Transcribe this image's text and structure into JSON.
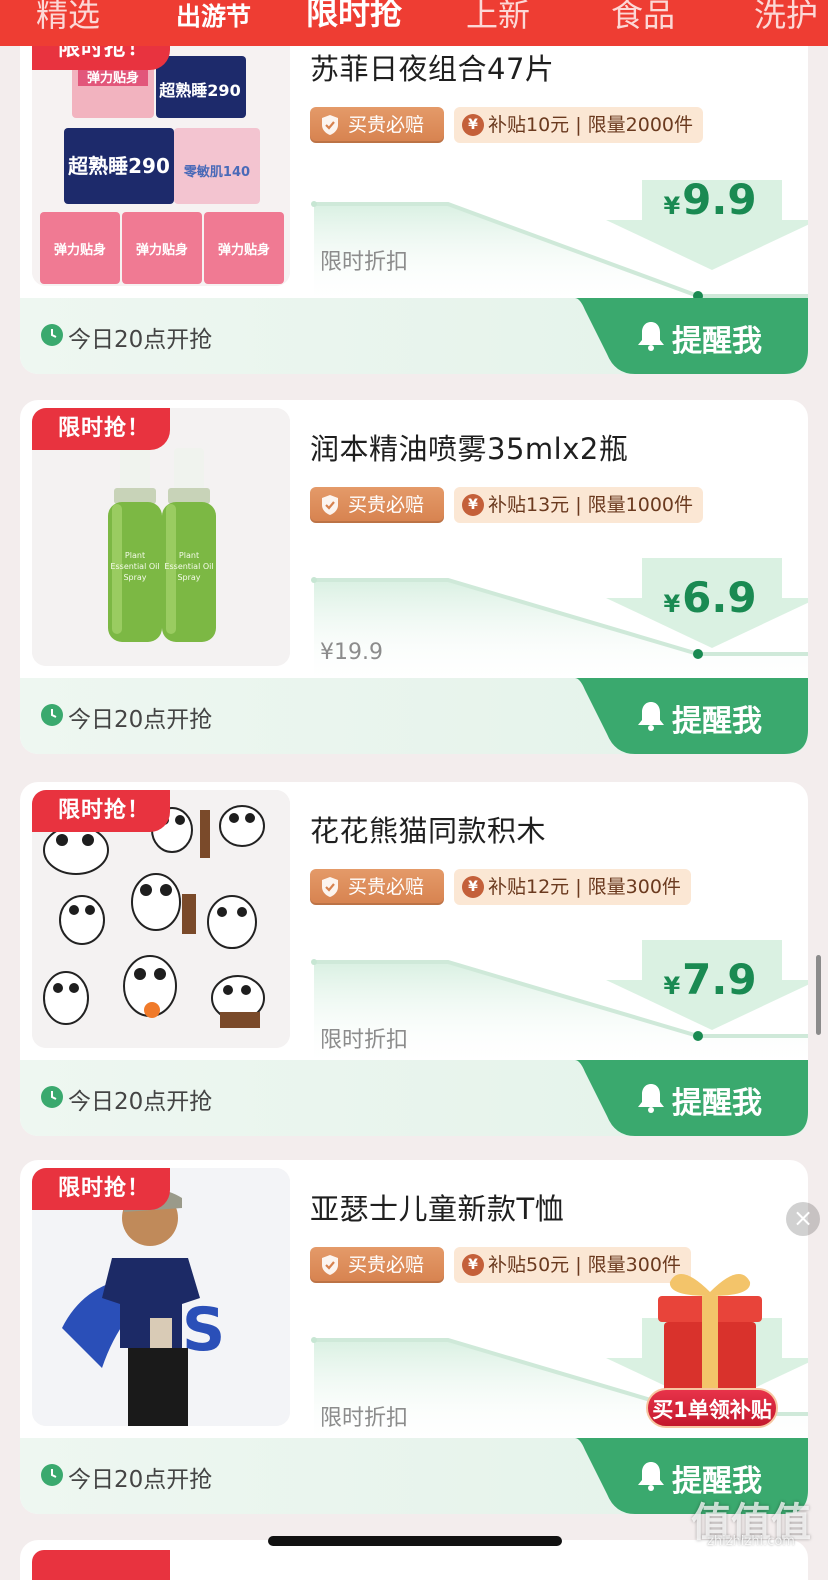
{
  "tabs": [
    "精选",
    "出游节",
    "限时抢",
    "上新",
    "食品",
    "洗护"
  ],
  "products": [
    {
      "flash_tag": "限时抢！",
      "title": "苏菲日夜组合47片",
      "guarantee": "买贵必赔",
      "subsidy_coin": "¥",
      "subsidy": "补贴10元 | 限量2000件",
      "trend_label": "限时折扣",
      "price_symbol": "¥",
      "price": "9.9",
      "start_time": "今日20点开抢",
      "remind": "提醒我",
      "image": "sofy-pads-packs"
    },
    {
      "flash_tag": "限时抢！",
      "title": "润本精油喷雾35mlx2瓶",
      "guarantee": "买贵必赔",
      "subsidy_coin": "¥",
      "subsidy": "补贴13元 | 限量1000件",
      "trend_label": "¥19.9",
      "price_symbol": "¥",
      "price": "6.9",
      "start_time": "今日20点开抢",
      "remind": "提醒我",
      "image": "green-spray-bottles"
    },
    {
      "flash_tag": "限时抢！",
      "title": "花花熊猫同款积木",
      "guarantee": "买贵必赔",
      "subsidy_coin": "¥",
      "subsidy": "补贴12元 | 限量300件",
      "trend_label": "限时折扣",
      "price_symbol": "¥",
      "price": "7.9",
      "start_time": "今日20点开抢",
      "remind": "提醒我",
      "image": "panda-block-figures"
    },
    {
      "flash_tag": "限时抢！",
      "title": "亚瑟士儿童新款T恤",
      "guarantee": "买贵必赔",
      "subsidy_coin": "¥",
      "subsidy": "补贴50元 | 限量300件",
      "trend_label": "限时折扣",
      "price_symbol": "",
      "price": "",
      "start_time": "今日20点开抢",
      "remind": "提醒我",
      "image": "kid-navy-tshirt"
    }
  ],
  "gift_popup": {
    "label": "买1单领补贴",
    "close": "×"
  },
  "watermark": {
    "text": "值值值",
    "url": "zhizhizhi.com"
  },
  "colors": {
    "brand_red": "#ee3d33",
    "flash_tag": "#e8333f",
    "price_green": "#1a8a52",
    "remind_green": "#3aa96e",
    "guarantee_orange": "#d7824f",
    "subsidy_bg": "#fbe7d4"
  }
}
